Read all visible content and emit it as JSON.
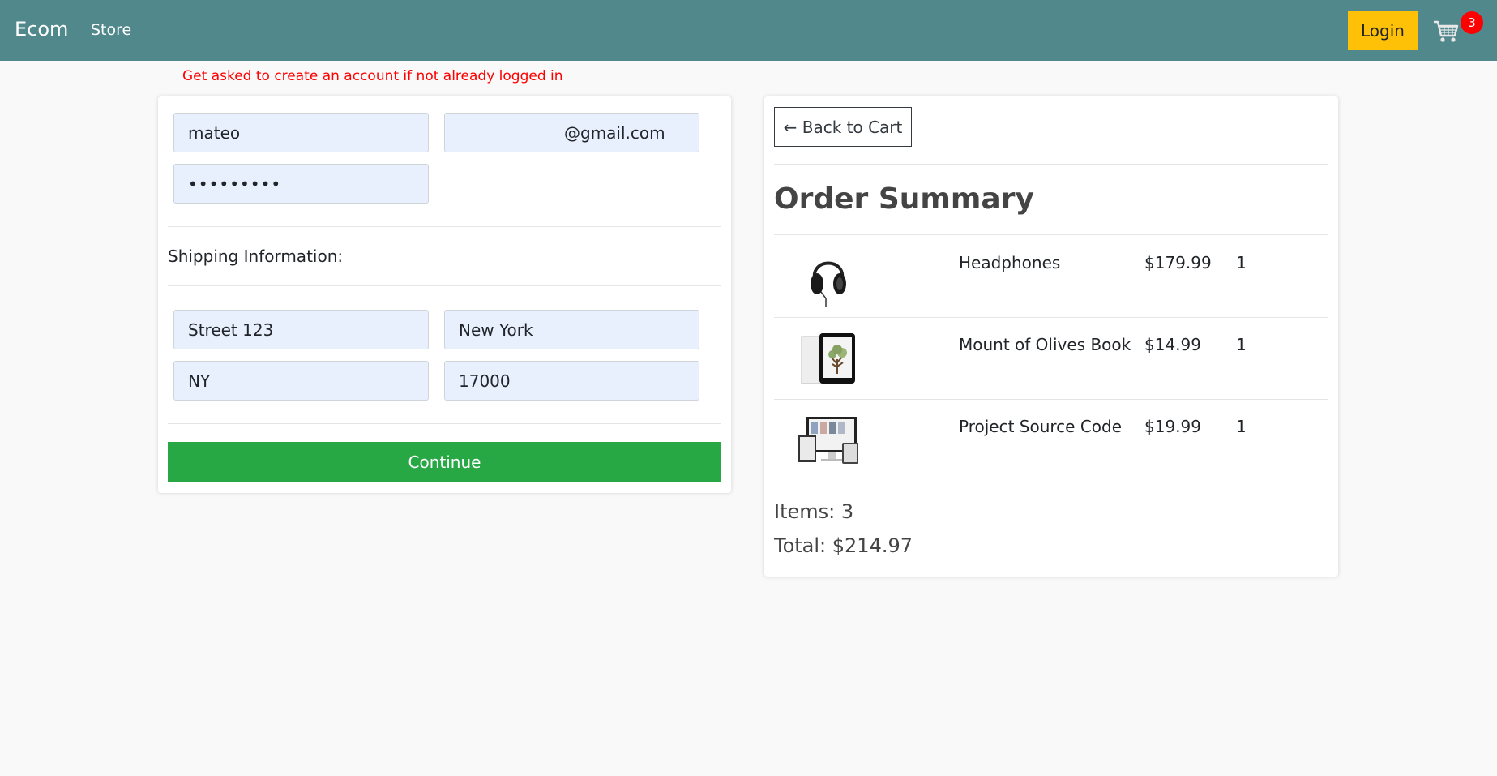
{
  "navbar": {
    "brand": "Ecom",
    "store_link": "Store",
    "login_label": "Login",
    "cart_count": "3",
    "accent": "#51888c"
  },
  "note": "Get asked to create an account if not already logged in",
  "form": {
    "name_value": "mateo",
    "email_value": "@gmail.com",
    "password_value": "•••••••••",
    "shipping_label": "Shipping Information:",
    "address_value": "Street 123",
    "city_value": "New York",
    "state_value": "NY",
    "zip_value": "17000",
    "continue_label": "Continue"
  },
  "summary": {
    "back_label": "← Back to Cart",
    "title": "Order Summary",
    "items": [
      {
        "name": "Headphones",
        "price": "$179.99",
        "qty": "1",
        "icon": "headphones-image"
      },
      {
        "name": "Mount of Olives Book",
        "price": "$14.99",
        "qty": "1",
        "icon": "book-tablet-image"
      },
      {
        "name": "Project Source Code",
        "price": "$19.99",
        "qty": "1",
        "icon": "source-code-devices-image"
      }
    ],
    "items_text": "Items: 3",
    "total_text": "Total: $214.97"
  }
}
